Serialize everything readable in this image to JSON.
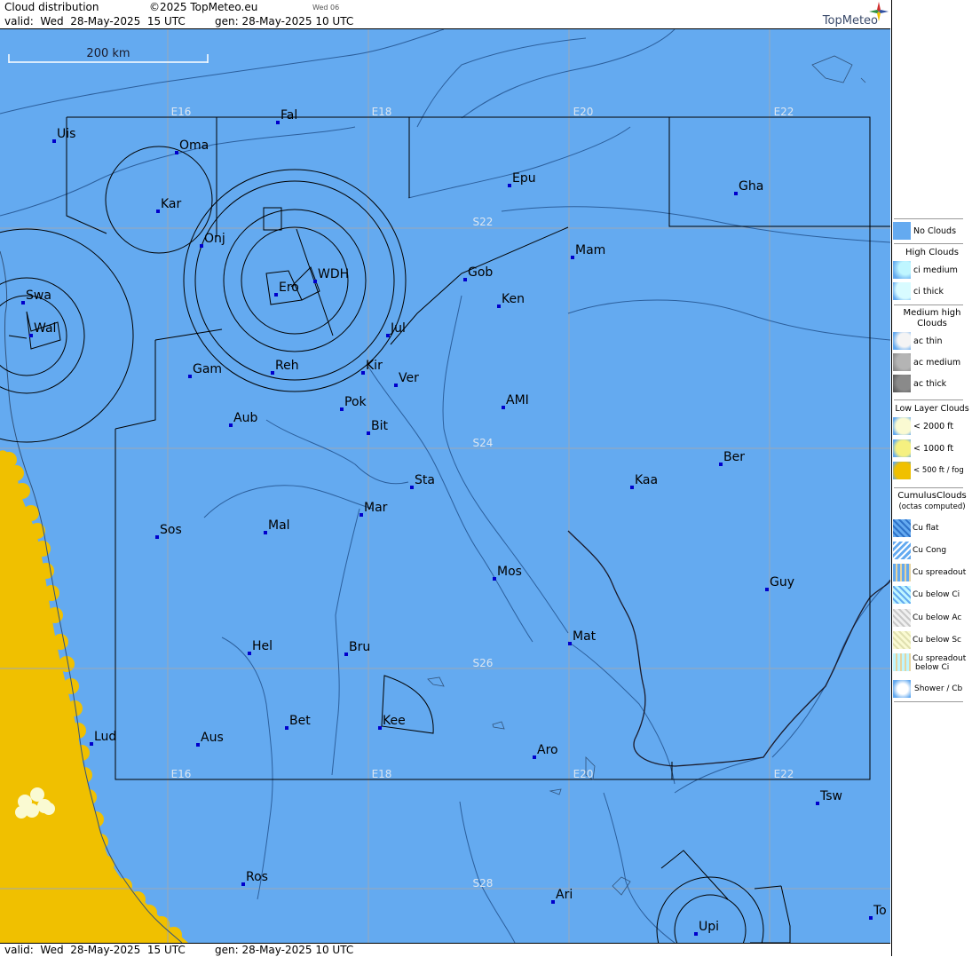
{
  "header": {
    "product": "Cloud distribution",
    "copyright": "©2025 TopMeteo.eu",
    "step": "Wed 06",
    "valid": "valid:  Wed  28-May-2025  15 UTC",
    "gen": "gen: 28-May-2025 10 UTC",
    "brand": "TopMeteo"
  },
  "footer": {
    "valid": "valid:  Wed  28-May-2025  15 UTC",
    "gen": "gen: 28-May-2025 10 UTC"
  },
  "scale": {
    "label": "200 km"
  },
  "colors": {
    "no_clouds": "#64aaf0",
    "low_fog": "#f0c000",
    "low_1000": "#f5f080",
    "low_2000": "#fafad2",
    "grid": "#9aa8b8",
    "water": "#31527a"
  },
  "grid_labels": {
    "lon_top": [
      "E16",
      "E18",
      "E20",
      "E22"
    ],
    "lon_bottom": [
      "E16",
      "E18",
      "E20",
      "E22"
    ],
    "lat": [
      "S22",
      "S24",
      "S26",
      "S28"
    ]
  },
  "places": [
    {
      "name": "Uis"
    },
    {
      "name": "Fal"
    },
    {
      "name": "Oma"
    },
    {
      "name": "Kar"
    },
    {
      "name": "Onj"
    },
    {
      "name": "Epu"
    },
    {
      "name": "Gha"
    },
    {
      "name": "Mam"
    },
    {
      "name": "Gob"
    },
    {
      "name": "Ken"
    },
    {
      "name": "WDH"
    },
    {
      "name": "Ero"
    },
    {
      "name": "Swa"
    },
    {
      "name": "Wal"
    },
    {
      "name": "Jul"
    },
    {
      "name": "Gam"
    },
    {
      "name": "Reh"
    },
    {
      "name": "Kir"
    },
    {
      "name": "Ver"
    },
    {
      "name": "Pok"
    },
    {
      "name": "AMI"
    },
    {
      "name": "Aub"
    },
    {
      "name": "Bit"
    },
    {
      "name": "Ber"
    },
    {
      "name": "Kaa"
    },
    {
      "name": "Sta"
    },
    {
      "name": "Mar"
    },
    {
      "name": "Sos"
    },
    {
      "name": "Mal"
    },
    {
      "name": "Mos"
    },
    {
      "name": "Guy"
    },
    {
      "name": "Mat"
    },
    {
      "name": "Hel"
    },
    {
      "name": "Bru"
    },
    {
      "name": "Bet"
    },
    {
      "name": "Kee"
    },
    {
      "name": "Lud"
    },
    {
      "name": "Aus"
    },
    {
      "name": "Aro"
    },
    {
      "name": "Tsw"
    },
    {
      "name": "Ros"
    },
    {
      "name": "Ari"
    },
    {
      "name": "Upi"
    },
    {
      "name": "To"
    }
  ],
  "legend": {
    "no_clouds": "No Clouds",
    "high_head": "High Clouds",
    "ci_medium": "ci medium",
    "ci_thick": "ci thick",
    "medium_head_1": "Medium high",
    "medium_head_2": "Clouds",
    "ac_thin": "ac thin",
    "ac_medium": "ac medium",
    "ac_thick": "ac thick",
    "low_head": "Low Layer Clouds",
    "low_2000": "< 2000 ft",
    "low_1000": "< 1000 ft",
    "low_500": "< 500 ft / fog",
    "cu_head_1": "CumulusClouds",
    "cu_head_2": "(octas computed)",
    "cu_flat": "Cu flat",
    "cu_cong": "Cu Cong",
    "cu_spread": "Cu spreadout",
    "cu_below_ci": "Cu below Ci",
    "cu_below_ac": "Cu below Ac",
    "cu_below_sc": "Cu below Sc",
    "cu_spread_ci_1": "Cu spreadout",
    "cu_spread_ci_2": "below Ci",
    "shower": "Shower / Cb"
  }
}
